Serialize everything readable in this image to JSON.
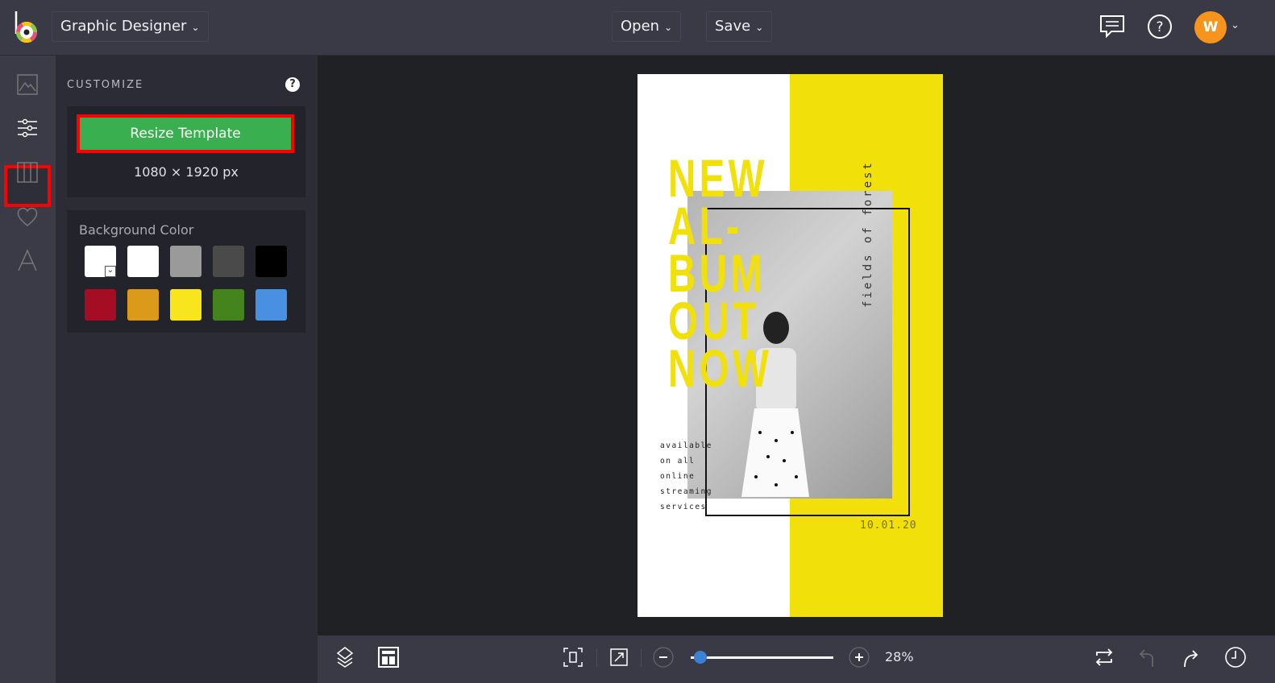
{
  "header": {
    "app_menu": "Graphic Designer",
    "open_label": "Open",
    "save_label": "Save",
    "avatar_initial": "W"
  },
  "panel": {
    "title": "CUSTOMIZE",
    "resize_label": "Resize Template",
    "dimensions": "1080 × 1920 px",
    "bg_label": "Background Color",
    "swatches": [
      "#ffffff",
      "#ffffff",
      "#9a9a9a",
      "#4a4a4a",
      "#000000",
      "#a50d24",
      "#dc9a1a",
      "#f9e51e",
      "#45841c",
      "#4a90e2"
    ]
  },
  "poster": {
    "headline": [
      "NEW",
      "AL-",
      "BUM",
      "OUT",
      "NOW"
    ],
    "side_text": "fields of forest",
    "availability": [
      "available",
      "on all",
      "online",
      "streaming",
      "services"
    ],
    "date": "10.01.20",
    "accent": "#f2e00a"
  },
  "bottom": {
    "zoom": "28%",
    "zoom_value": 28
  }
}
